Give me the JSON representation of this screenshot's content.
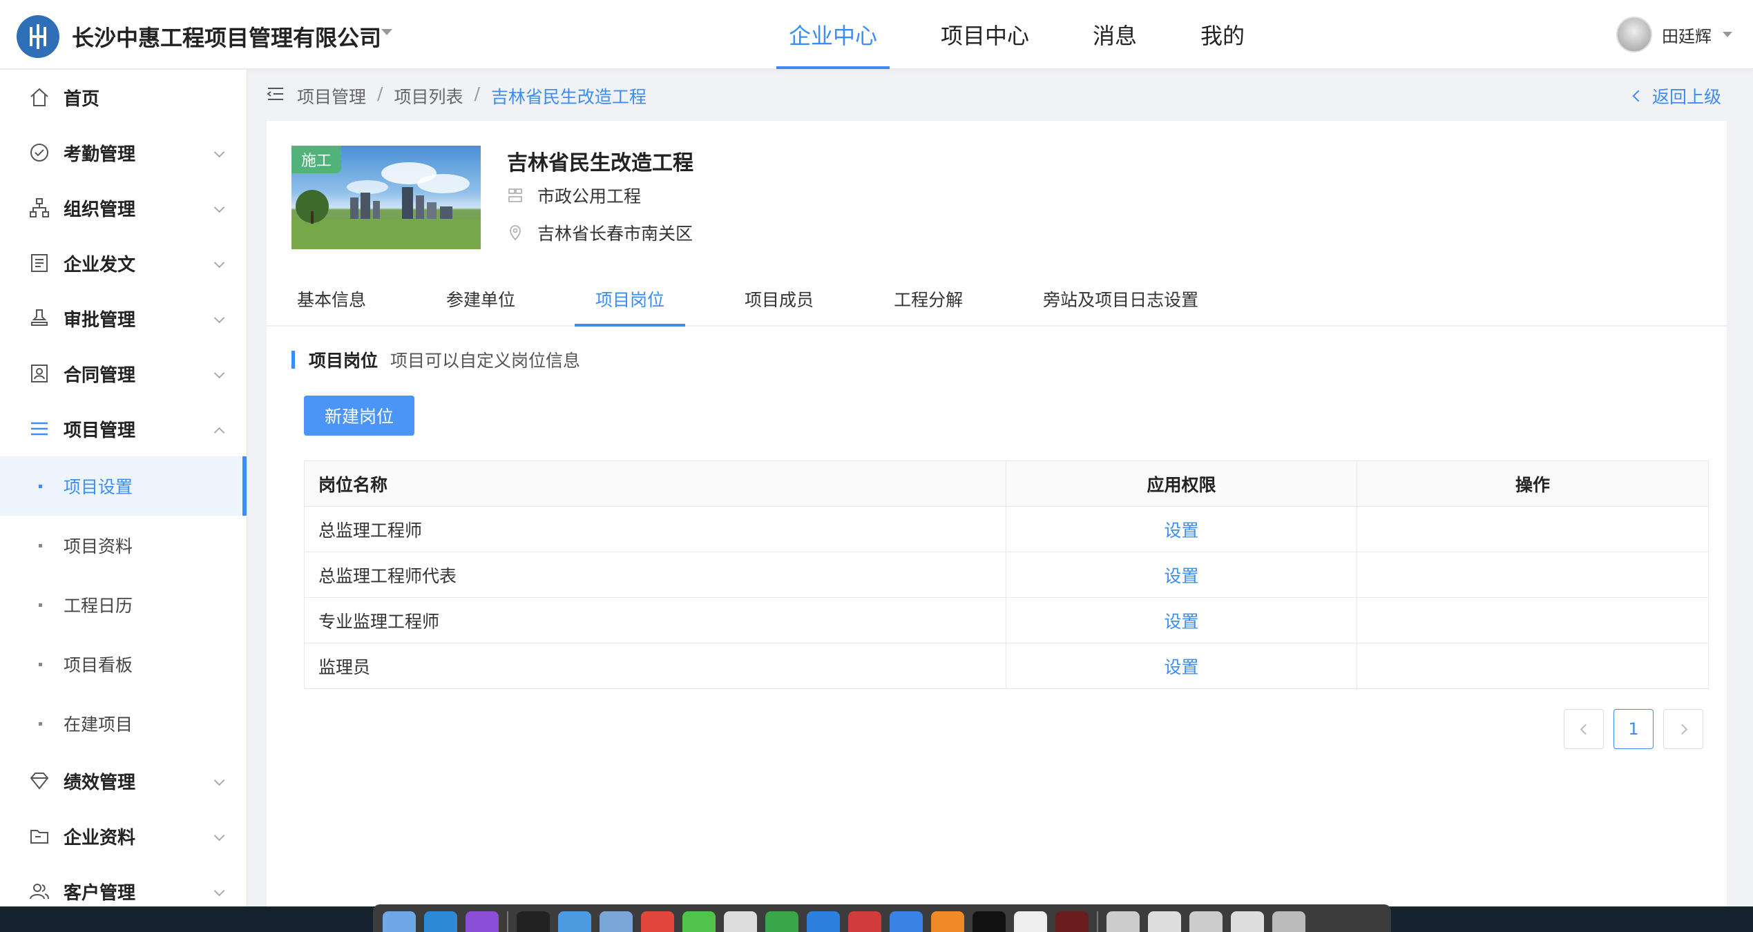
{
  "header": {
    "company": "长沙中惠工程项目管理有限公司",
    "nav": [
      {
        "label": "企业中心",
        "active": true
      },
      {
        "label": "项目中心",
        "active": false
      },
      {
        "label": "消息",
        "active": false
      },
      {
        "label": "我的",
        "active": false
      }
    ],
    "user_name": "田廷辉"
  },
  "sidebar": {
    "items": [
      {
        "label": "首页",
        "icon": "home-icon"
      },
      {
        "label": "考勤管理",
        "icon": "check-circle-icon"
      },
      {
        "label": "组织管理",
        "icon": "org-chart-icon"
      },
      {
        "label": "企业发文",
        "icon": "document-icon"
      },
      {
        "label": "审批管理",
        "icon": "stamp-icon"
      },
      {
        "label": "合同管理",
        "icon": "contract-icon"
      },
      {
        "label": "项目管理",
        "icon": "list-icon"
      },
      {
        "label": "绩效管理",
        "icon": "diamond-icon"
      },
      {
        "label": "企业资料",
        "icon": "folder-icon"
      },
      {
        "label": "客户管理",
        "icon": "users-icon"
      }
    ],
    "sub_items": [
      {
        "label": "项目设置",
        "active": true
      },
      {
        "label": "项目资料"
      },
      {
        "label": "工程日历"
      },
      {
        "label": "项目看板"
      },
      {
        "label": "在建项目"
      }
    ]
  },
  "breadcrumb": {
    "items": [
      "项目管理",
      "项目列表",
      "吉林省民生改造工程"
    ],
    "separator": "/",
    "back": "返回上级"
  },
  "project": {
    "status_tag": "施工",
    "title": "吉林省民生改造工程",
    "category": "市政公用工程",
    "location": "吉林省长春市南关区"
  },
  "tabs": [
    {
      "label": "基本信息"
    },
    {
      "label": "参建单位"
    },
    {
      "label": "项目岗位",
      "active": true
    },
    {
      "label": "项目成员"
    },
    {
      "label": "工程分解"
    },
    {
      "label": "旁站及项目日志设置"
    }
  ],
  "section": {
    "title": "项目岗位",
    "description": "项目可以自定义岗位信息",
    "new_button": "新建岗位"
  },
  "table": {
    "headers": [
      "岗位名称",
      "应用权限",
      "操作"
    ],
    "rows": [
      {
        "name": "总监理工程师",
        "permission": "设置",
        "action": ""
      },
      {
        "name": "总监理工程师代表",
        "permission": "设置",
        "action": ""
      },
      {
        "name": "专业监理工程师",
        "permission": "设置",
        "action": ""
      },
      {
        "name": "监理员",
        "permission": "设置",
        "action": ""
      }
    ]
  },
  "pagination": {
    "current": "1"
  },
  "colors": {
    "accent": "#3b8df5",
    "tag": "#52b37a",
    "logo": "#2f6fb8"
  }
}
